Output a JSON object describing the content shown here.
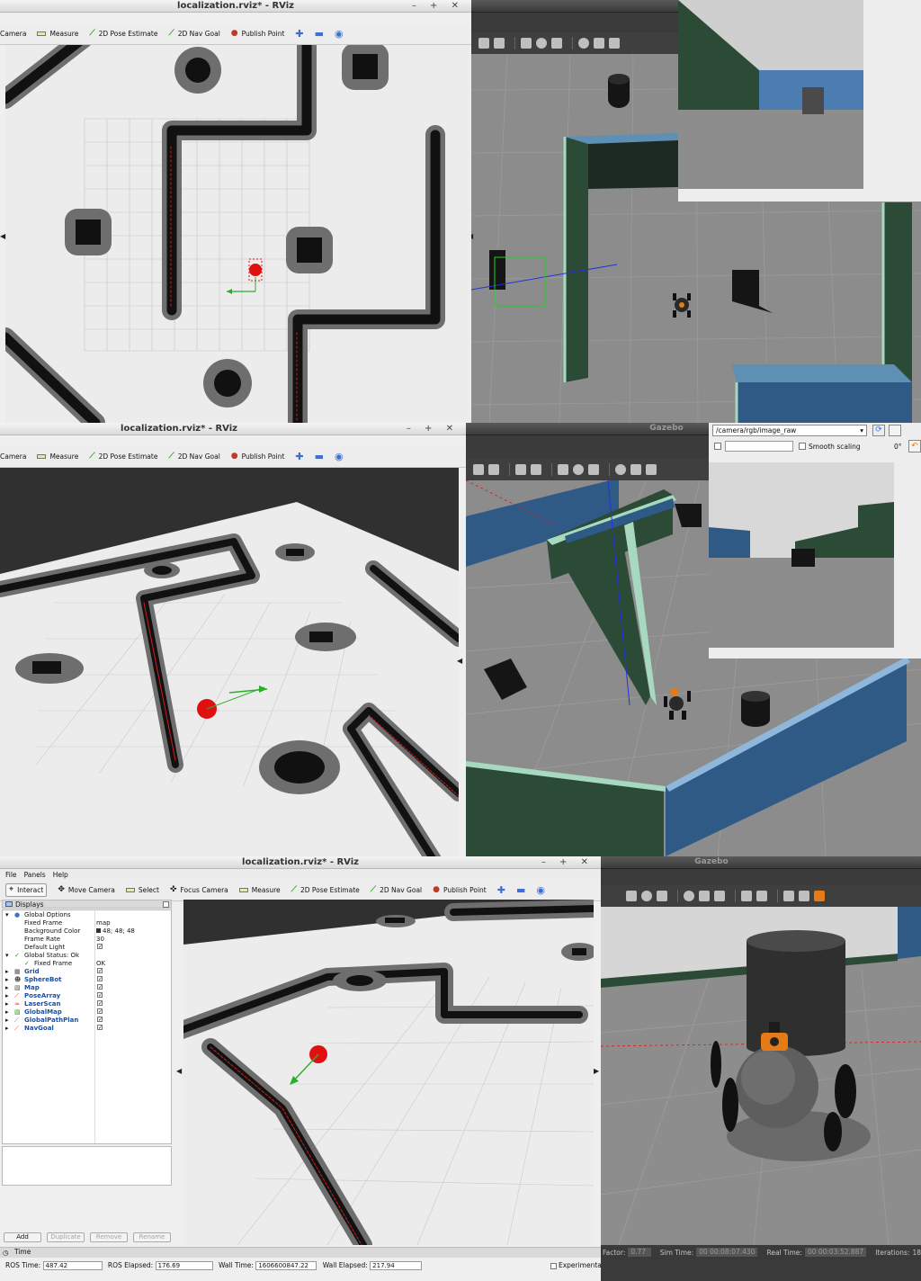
{
  "rviz": {
    "title": "localization.rviz* - RViz",
    "toolbar": {
      "interact": "Interact",
      "move_camera": "Move Camera",
      "move_camera_clipped": "Camera",
      "select": "Select",
      "focus_camera": "Focus Camera",
      "measure": "Measure",
      "pose_estimate": "2D Pose Estimate",
      "nav_goal": "2D Nav Goal",
      "publish_point": "Publish Point"
    },
    "menu": {
      "file": "File",
      "panels": "Panels",
      "help": "Help"
    },
    "displays_title": "Displays",
    "global_options": {
      "label": "Global Options",
      "rows": [
        {
          "key": "Fixed Frame",
          "value": "map"
        },
        {
          "key": "Background Color",
          "value": "48; 48; 48"
        },
        {
          "key": "Frame Rate",
          "value": "30"
        },
        {
          "key": "Default Light",
          "value": "✓"
        }
      ]
    },
    "global_status": {
      "label": "Global Status: Ok",
      "fixed_frame_label": "Fixed Frame",
      "fixed_frame_value": "OK"
    },
    "displays": [
      "Grid",
      "SphereBot",
      "Map",
      "PoseArray",
      "LaserScan",
      "GlobalMap",
      "GlobalPathPlan",
      "NavGoal"
    ],
    "buttons": {
      "add": "Add",
      "duplicate": "Duplicate",
      "remove": "Remove",
      "rename": "Rename"
    },
    "time": {
      "title": "Time",
      "ros_time_label": "ROS Time:",
      "ros_time": "487.42",
      "ros_elapsed_label": "ROS Elapsed:",
      "ros_elapsed": "176.69",
      "wall_time_label": "Wall Time:",
      "wall_time": "1606600847.22",
      "wall_elapsed_label": "Wall Elapsed:",
      "wall_elapsed": "217.94",
      "experimental": "Experimental"
    }
  },
  "gazebo": {
    "title": "Gazebo",
    "image_view": {
      "topic": "/camera/rgb/image_raw",
      "smooth_scaling": "Smooth scaling",
      "rotation": "0°"
    },
    "footer": {
      "factor_label": "Factor:",
      "factor": "0.77",
      "sim_time_label": "Sim Time:",
      "sim_time": "00 00:08:07.430",
      "real_time_label": "Real Time:",
      "real_time": "00 00:03:52.887",
      "iterations_label": "Iterations:",
      "iterations": "18"
    }
  },
  "colors": {
    "map_free": "#ececec",
    "map_wall": "#111111",
    "map_inflation": "#6e6e6e",
    "wall_blue": "#2f5a85",
    "wall_green": "#2c4b36",
    "robot_red": "#e01010"
  }
}
